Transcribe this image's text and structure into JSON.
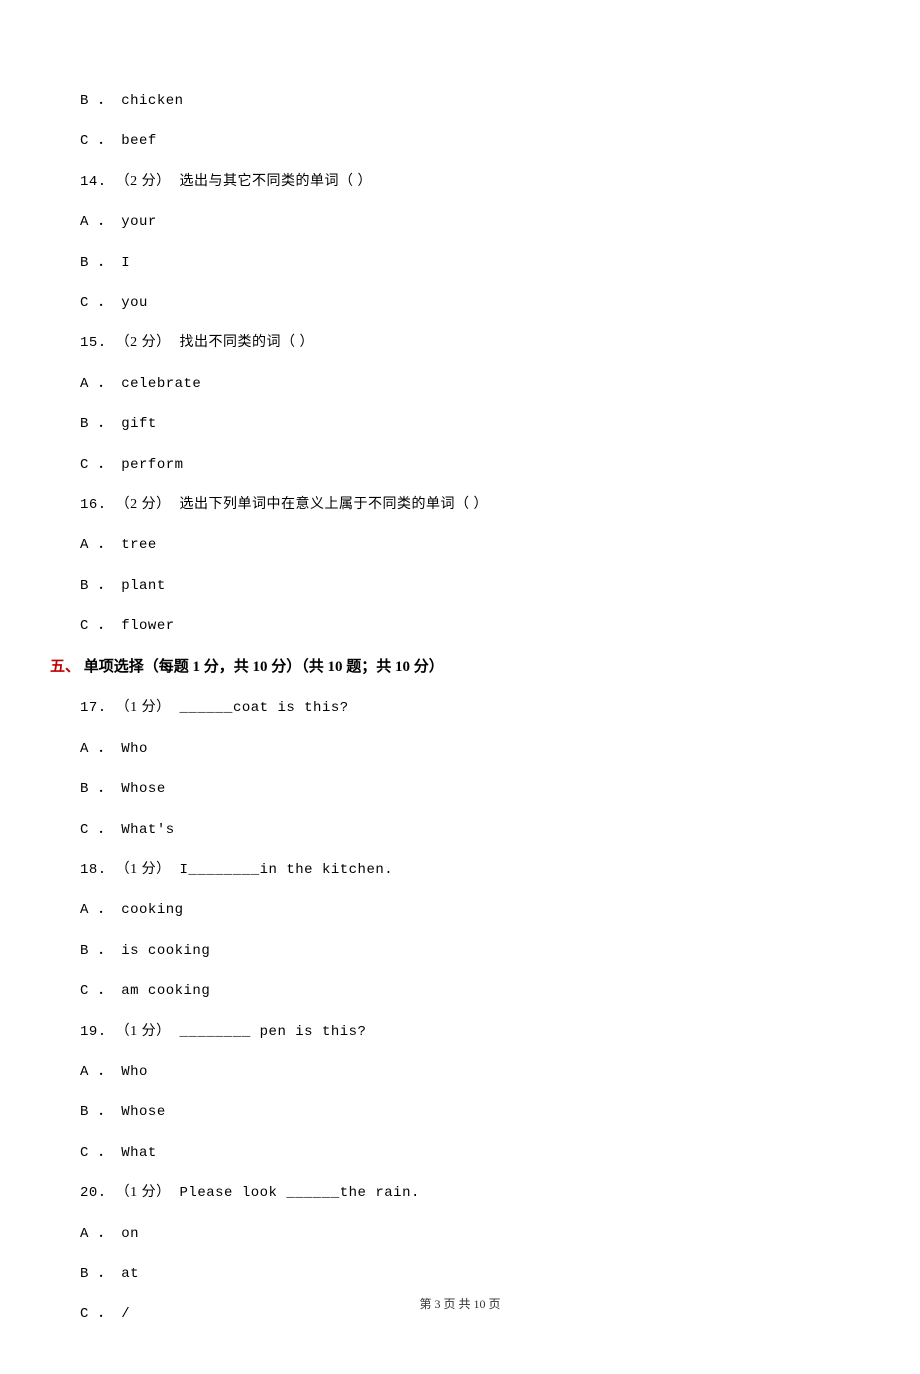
{
  "options_top": [
    {
      "label": "B ．",
      "value": "chicken"
    },
    {
      "label": "C ．",
      "value": "beef"
    }
  ],
  "q14": {
    "num": "14.",
    "score": "（2 分）",
    "text": " 选出与其它不同类的单词（   ）",
    "options": [
      {
        "label": "A ．",
        "value": "your"
      },
      {
        "label": "B ．",
        "value": "I"
      },
      {
        "label": "C ．",
        "value": "you"
      }
    ]
  },
  "q15": {
    "num": "15.",
    "score": "（2 分）",
    "text": " 找出不同类的词（   ）",
    "options": [
      {
        "label": "A ．",
        "value": "celebrate"
      },
      {
        "label": "B ．",
        "value": "gift"
      },
      {
        "label": "C ．",
        "value": "perform"
      }
    ]
  },
  "q16": {
    "num": "16.",
    "score": "（2 分）",
    "text": " 选出下列单词中在意义上属于不同类的单词（   ）",
    "options": [
      {
        "label": "A ．",
        "value": "tree"
      },
      {
        "label": "B ．",
        "value": "plant"
      },
      {
        "label": "C ．",
        "value": "flower"
      }
    ]
  },
  "section5": {
    "num": "五、",
    "title": " 单项选择（每题 1 分，共 10 分）（共 10 题；共 10 分）"
  },
  "q17": {
    "num": "17.",
    "score": "（1 分）",
    "text": " ______coat is this?",
    "options": [
      {
        "label": "A ．",
        "value": "Who"
      },
      {
        "label": "B ．",
        "value": "Whose"
      },
      {
        "label": "C ．",
        "value": "What's"
      }
    ]
  },
  "q18": {
    "num": "18.",
    "score": "（1 分）",
    "text": " I________in the kitchen.",
    "options": [
      {
        "label": "A ．",
        "value": "cooking"
      },
      {
        "label": "B ．",
        "value": "is cooking"
      },
      {
        "label": "C ．",
        "value": "am cooking"
      }
    ]
  },
  "q19": {
    "num": "19.",
    "score": "（1 分）",
    "text": " ________ pen is this?",
    "options": [
      {
        "label": "A ．",
        "value": "Who"
      },
      {
        "label": "B ．",
        "value": "Whose"
      },
      {
        "label": "C ．",
        "value": "What"
      }
    ]
  },
  "q20": {
    "num": "20.",
    "score": "（1 分）",
    "text": " Please look ______the rain.",
    "options": [
      {
        "label": "A ．",
        "value": "on"
      },
      {
        "label": "B ．",
        "value": "at"
      },
      {
        "label": "C ．",
        "value": "/"
      }
    ]
  },
  "footer": "第 3 页 共 10 页"
}
